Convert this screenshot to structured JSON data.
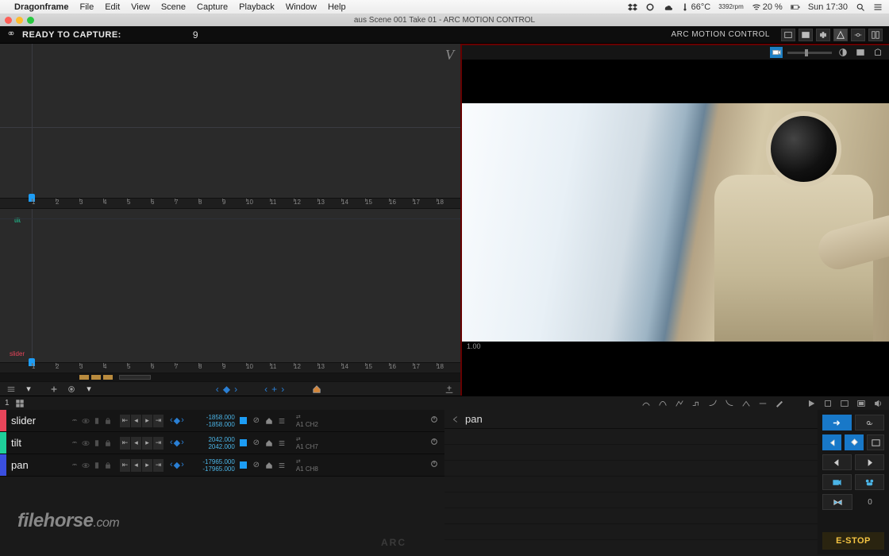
{
  "menubar": {
    "app": "Dragonframe",
    "items": [
      "File",
      "Edit",
      "View",
      "Scene",
      "Capture",
      "Playback",
      "Window",
      "Help"
    ],
    "status": {
      "temp": "66°C",
      "rpm": "3392rpm",
      "wifi": "20 %",
      "time": "Sun 17:30"
    }
  },
  "window": {
    "title": "aus  Scene 001  Take 01 - ARC MOTION CONTROL"
  },
  "capture": {
    "ready": "READY TO CAPTURE:",
    "frame": "9",
    "mode": "ARC MOTION CONTROL"
  },
  "graph": {
    "ticks": [
      "1",
      "2",
      "3",
      "4",
      "5",
      "6",
      "7",
      "8",
      "9",
      "10",
      "11",
      "12",
      "13",
      "14",
      "15",
      "16",
      "17",
      "18"
    ],
    "label_tilt": "tilt",
    "label_slider": "slider",
    "v_mark": "V"
  },
  "viewport": {
    "zoom": "1.00"
  },
  "ptoolbar": {
    "frame": "1"
  },
  "axes": [
    {
      "name": "slider",
      "color": "#e8455a",
      "v1": "-1858.000",
      "v2": "-1858.000",
      "ch": "A1 CH2"
    },
    {
      "name": "tilt",
      "color": "#1fcf9a",
      "v1": "2042.000",
      "v2": "2042.000",
      "ch": "A1 CH7"
    },
    {
      "name": "pan",
      "color": "#3a4fe0",
      "v1": "-17965.000",
      "v2": "-17965.000",
      "ch": "A1 CH8"
    }
  ],
  "detail": {
    "axis": "pan"
  },
  "controlpad": {
    "count": "0",
    "estop": "E-STOP"
  },
  "watermark": {
    "t1": "filehorse",
    "t2": ".com",
    "arc": "ARC"
  }
}
